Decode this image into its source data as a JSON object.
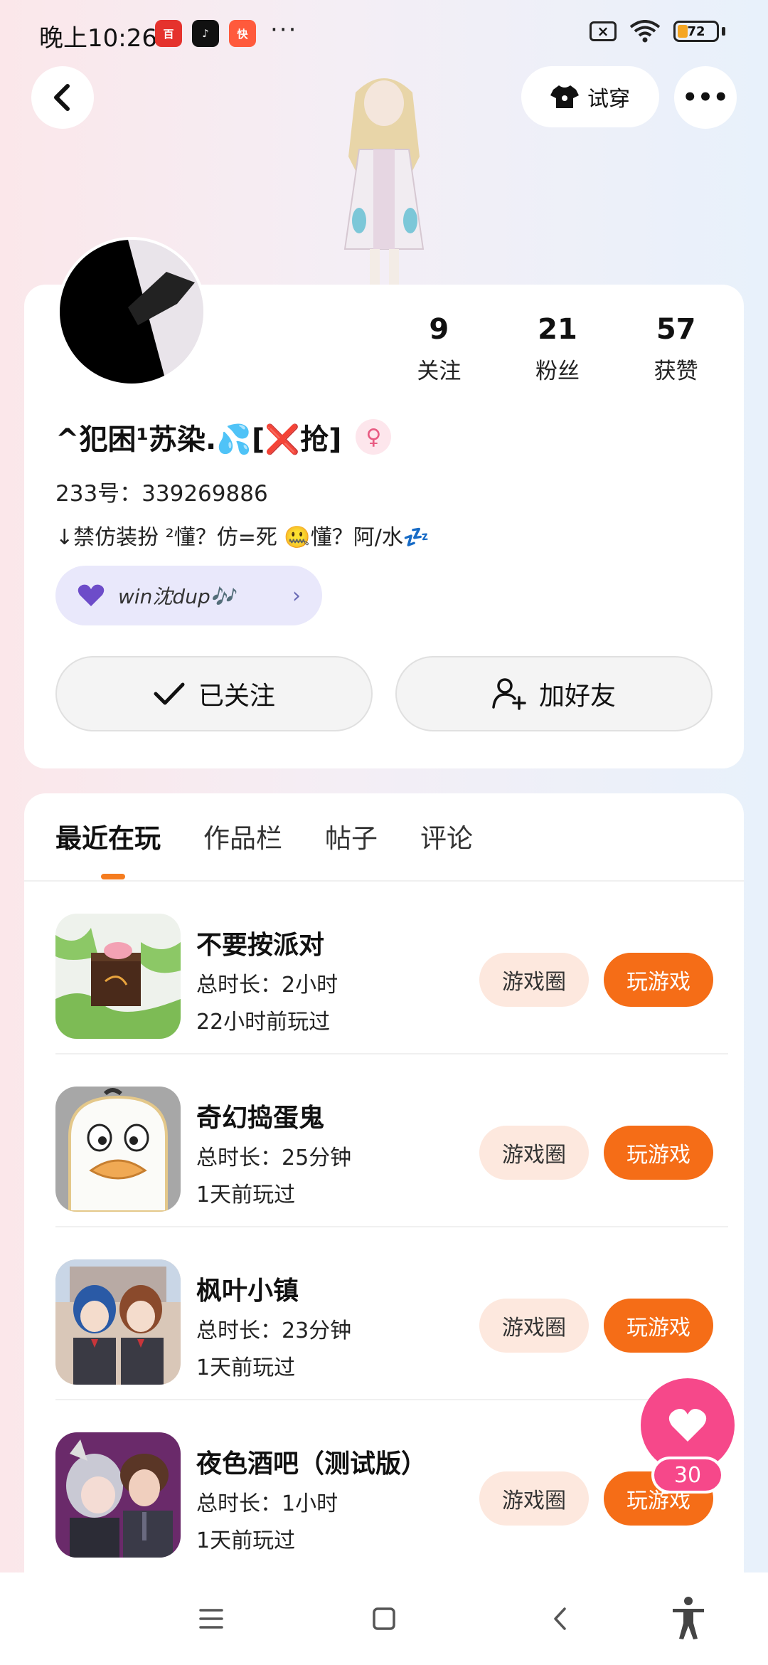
{
  "status_bar": {
    "time": "晚上10:26",
    "app_badges": [
      {
        "name": "red-app-icon",
        "color": "#e5322d",
        "text": "百"
      },
      {
        "name": "tiktok-icon",
        "color": "#111111",
        "text": "♪"
      },
      {
        "name": "kuaishou-icon",
        "color": "#ff5a3c",
        "text": "快"
      }
    ],
    "overflow": "···",
    "sim": "×",
    "battery": "72"
  },
  "header": {
    "try_on_label": "试穿",
    "more_label": "•••"
  },
  "profile": {
    "stats": [
      {
        "value": "9",
        "label": "关注"
      },
      {
        "value": "21",
        "label": "粉丝"
      },
      {
        "value": "57",
        "label": "获赞"
      }
    ],
    "nickname": "^犯困¹苏染.💦[❌抢]",
    "gender_symbol": "♀",
    "user_id": "233号：339269886",
    "bio": "↓禁仿装扮 ²懂？仿=死 🤐懂？阿/水💤",
    "tag": {
      "text": "win沈dup🎶",
      "chevron": "›"
    },
    "followed_label": "已关注",
    "add_friend_label": "加好友"
  },
  "tabs": [
    "最近在玩",
    "作品栏",
    "帖子",
    "评论"
  ],
  "games": [
    {
      "title": "不要按派对",
      "duration": "总时长：2小时",
      "last_played": "22小时前玩过",
      "circle_label": "游戏圈",
      "play_label": "玩游戏"
    },
    {
      "title": "奇幻捣蛋鬼",
      "duration": "总时长：25分钟",
      "last_played": "1天前玩过",
      "circle_label": "游戏圈",
      "play_label": "玩游戏"
    },
    {
      "title": "枫叶小镇",
      "duration": "总时长：23分钟",
      "last_played": "1天前玩过",
      "circle_label": "游戏圈",
      "play_label": "玩游戏"
    },
    {
      "title": "夜色酒吧（测试版）",
      "duration": "总时长：1小时",
      "last_played": "1天前玩过",
      "circle_label": "游戏圈",
      "play_label": "玩游戏"
    }
  ],
  "like": {
    "count": "30"
  },
  "colors": {
    "accent": "#f56d17",
    "like": "#f6488a"
  }
}
